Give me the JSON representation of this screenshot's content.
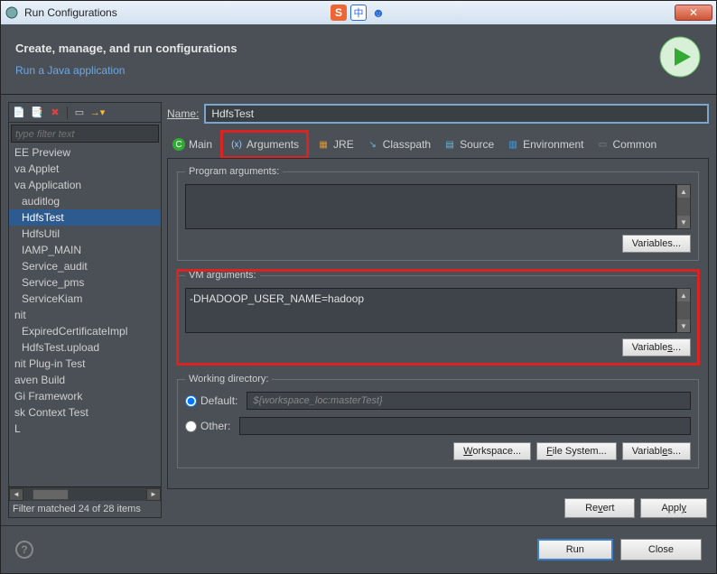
{
  "titlebar": {
    "title": "Run Configurations",
    "ime_zh": "中"
  },
  "header": {
    "title": "Create, manage, and run configurations",
    "subtitle": "Run a Java application"
  },
  "left": {
    "filter_placeholder": "type filter text",
    "items": [
      "EE Preview",
      "va Applet",
      "va Application",
      "auditlog",
      "HdfsTest",
      "HdfsUtil",
      "IAMP_MAIN",
      "Service_audit",
      "Service_pms",
      "ServiceKiam",
      "nit",
      "ExpiredCertificateImpl",
      "HdfsTest.upload",
      "nit Plug-in Test",
      "aven Build",
      "Gi Framework",
      "sk Context Test",
      "L"
    ],
    "selected_index": 4,
    "indented": [
      3,
      4,
      5,
      6,
      7,
      8,
      9,
      11,
      12
    ],
    "filter_status": "Filter matched 24 of 28 items"
  },
  "name": {
    "label": "Name:",
    "value": "HdfsTest"
  },
  "tabs": [
    "Main",
    "Arguments",
    "JRE",
    "Classpath",
    "Source",
    "Environment",
    "Common"
  ],
  "tab_letters": [
    "M",
    "",
    "J",
    "",
    "",
    "",
    "C"
  ],
  "prog": {
    "legend": "Program arguments:",
    "value": "",
    "variables": "Variables..."
  },
  "vm": {
    "legend": "VM arguments:",
    "value": "-DHADOOP_USER_NAME=hadoop",
    "variables": "Variables..."
  },
  "wd": {
    "legend": "Working directory:",
    "default_label": "Default:",
    "default_value": "${workspace_loc:masterTest}",
    "other_label": "Other:",
    "workspace": "Workspace...",
    "filesystem": "File System...",
    "variables": "Variables..."
  },
  "actions": {
    "revert": "Revert",
    "apply": "Apply",
    "run": "Run",
    "close": "Close"
  }
}
